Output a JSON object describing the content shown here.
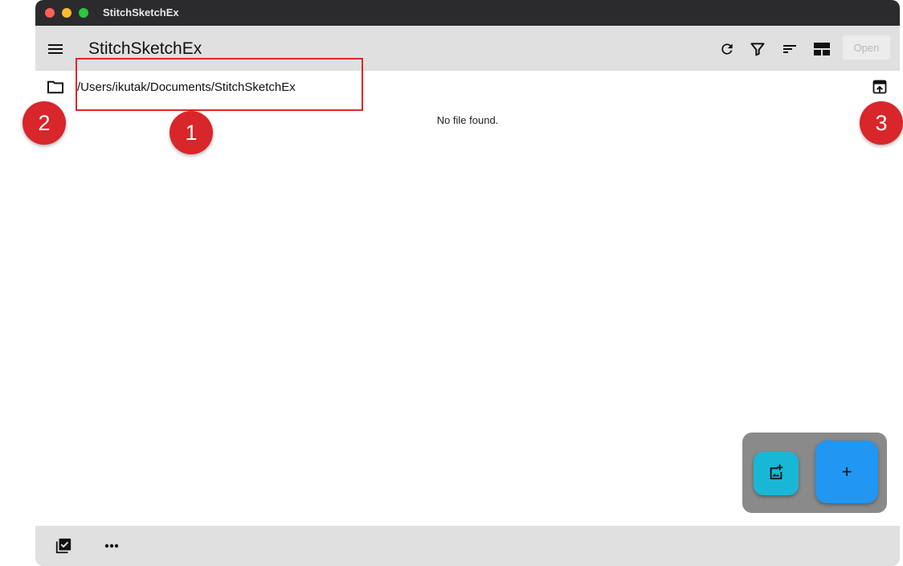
{
  "window": {
    "title": "StitchSketchEx"
  },
  "appbar": {
    "title": "StitchSketchEx",
    "menu_icon": "menu-icon",
    "refresh_icon": "refresh-icon",
    "filter_icon": "filter-icon",
    "sort_icon": "sort-icon",
    "view_icon": "view-layout-icon",
    "open_label": "Open"
  },
  "pathbar": {
    "path": "/Users/ikutak/Documents/StitchSketchEx",
    "folder_icon": "folder-icon",
    "open_folder_icon": "open-folder-icon"
  },
  "content": {
    "empty_message": "No file found."
  },
  "fabs": {
    "add_image_icon": "add-image-icon",
    "add_label": "+"
  },
  "bottombar": {
    "select_icon": "select-all-icon",
    "more_icon": "more-icon"
  },
  "annotations": {
    "badge_1": "1",
    "badge_2": "2",
    "badge_3": "3"
  },
  "colors": {
    "titlebar": "#2b2b2d",
    "appbar": "#e0e0e0",
    "fab_small": "#19b7d6",
    "fab_large": "#2196f3",
    "annotation_red": "#d8262a"
  }
}
